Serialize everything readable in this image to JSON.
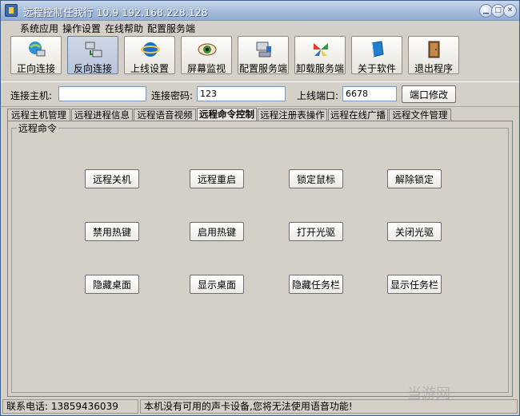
{
  "window": {
    "title": "远程控制任我行 10.9    192.168.228.128"
  },
  "menu": [
    "系统应用",
    "操作设置",
    "在线帮助",
    "配置服务端"
  ],
  "toolbar": [
    {
      "label": "正向连接",
      "icon": "globe-computer-icon"
    },
    {
      "label": "反向连接",
      "icon": "reverse-connect-icon"
    },
    {
      "label": "上线设置",
      "icon": "ie-globe-icon"
    },
    {
      "label": "屏幕监视",
      "icon": "eye-icon"
    },
    {
      "label": "配置服务端",
      "icon": "server-config-icon"
    },
    {
      "label": "卸载服务端",
      "icon": "butterfly-icon"
    },
    {
      "label": "关于软件",
      "icon": "book-icon"
    },
    {
      "label": "退出程序",
      "icon": "exit-door-icon"
    }
  ],
  "connection": {
    "host_label": "连接主机:",
    "host_value": "",
    "password_label": "连接密码:",
    "password_value": "123",
    "port_label": "上线端口:",
    "port_value": "6678",
    "port_button": "端口修改"
  },
  "tabs": [
    "远程主机管理",
    "远程进程信息",
    "远程语音视频",
    "远程命令控制",
    "远程注册表操作",
    "远程在线广播",
    "远程文件管理"
  ],
  "active_tab": "远程命令控制",
  "panel": {
    "group_title": "远程命令",
    "commands": [
      [
        "远程关机",
        "远程重启",
        "锁定鼠标",
        "解除锁定"
      ],
      [
        "禁用热键",
        "启用热键",
        "打开光驱",
        "关闭光驱"
      ],
      [
        "隐藏桌面",
        "显示桌面",
        "隐藏任务栏",
        "显示任务栏"
      ]
    ]
  },
  "status": {
    "phone": "联系电话: 13859436039",
    "message": "本机没有可用的声卡设备,您将无法使用语音功能!"
  },
  "watermark": "当游网"
}
